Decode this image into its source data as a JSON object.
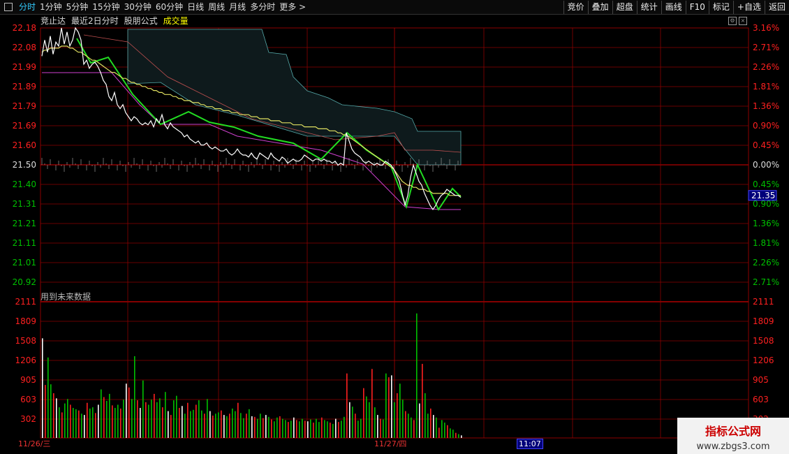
{
  "toolbar": {
    "periods": [
      "分时",
      "1分钟",
      "5分钟",
      "15分钟",
      "30分钟",
      "60分钟",
      "日线",
      "周线",
      "月线",
      "多分时",
      "更多 >"
    ],
    "active_index": 0,
    "right_items": [
      "竞价",
      "叠加",
      "超盘",
      "统计",
      "画线",
      "F10",
      "标记",
      "+自选",
      "返回"
    ]
  },
  "header": {
    "auction": "竞止达",
    "recent": "最近2日分时",
    "formula": "股朋公式",
    "volume": "成交量"
  },
  "price_axis": {
    "left": [
      "22.18",
      "22.08",
      "21.99",
      "21.89",
      "21.79",
      "21.69",
      "21.60",
      "21.50",
      "21.40",
      "21.31",
      "21.21",
      "21.11",
      "21.01",
      "20.92"
    ],
    "right": [
      "3.16%",
      "2.71%",
      "2.26%",
      "1.81%",
      "1.36%",
      "0.90%",
      "0.45%",
      "0.00%",
      "0.45%",
      "0.90%",
      "1.36%",
      "1.81%",
      "2.26%",
      "2.71%"
    ],
    "base_price": 21.5,
    "current_price": "21.35"
  },
  "volume_axis": {
    "labels": [
      "2111",
      "1809",
      "1508",
      "1206",
      "905",
      "603",
      "302"
    ],
    "max": 2111
  },
  "future_note": "用到未来数据",
  "dates": [
    "11/26/三",
    "11/27/四"
  ],
  "cursor_time": "11:07",
  "watermark": {
    "line1": "指标公式网",
    "line2": "www.zbgs3.com"
  },
  "colors": {
    "grid": "#8b0000",
    "up": "#ff2020",
    "down": "#00c000",
    "price": "#ffffff",
    "avg": "#e0e060",
    "accent": "#33ccff"
  },
  "chart_data": {
    "type": "line",
    "title": "",
    "x": [
      0,
      4,
      8,
      12,
      16,
      20,
      24,
      28,
      32,
      36,
      40,
      44,
      48,
      52,
      56,
      60,
      64,
      68,
      72,
      76,
      80,
      84,
      88,
      92,
      96,
      100,
      104,
      108,
      112,
      116,
      120,
      124,
      128,
      132,
      136,
      140,
      144,
      148,
      152,
      156,
      160,
      164,
      168,
      172,
      176,
      180,
      184,
      188,
      192,
      196,
      200,
      204,
      208,
      212,
      216,
      220,
      224,
      228,
      232,
      236,
      240,
      244,
      248,
      252,
      256,
      260,
      264,
      268,
      272,
      276,
      280,
      284,
      288,
      292,
      296,
      300,
      304,
      308,
      312,
      316,
      320,
      324,
      328,
      332,
      336,
      340,
      344,
      348,
      352,
      356,
      360,
      364,
      368,
      372,
      376,
      380,
      384,
      388,
      392,
      396,
      400,
      404,
      408,
      412,
      416,
      420,
      424,
      428,
      432,
      436,
      440,
      444,
      448,
      452,
      456,
      460,
      464,
      468,
      472,
      476,
      480,
      484,
      488,
      492,
      496,
      500,
      504,
      508,
      512,
      516,
      520,
      524,
      528,
      532,
      536,
      540,
      544,
      548,
      552,
      556,
      560,
      564,
      568,
      572,
      576,
      580,
      584,
      588,
      592,
      596,
      600
    ],
    "series": [
      {
        "values": [
          22.04,
          22.12,
          22.06,
          22.14,
          22.05,
          22.11,
          22.09,
          22.18,
          22.1,
          22.16,
          22.09,
          22.12,
          22.18,
          22.16,
          22.12,
          22.0,
          22.02,
          21.98,
          22.0,
          22.01,
          21.99,
          21.96,
          21.92,
          21.9,
          21.84,
          21.82,
          21.86,
          21.8,
          21.78,
          21.8,
          21.76,
          21.74,
          21.72,
          21.74,
          21.73,
          21.71,
          21.7,
          21.71,
          21.7,
          21.72,
          21.69,
          21.73,
          21.71,
          21.75,
          21.7,
          21.68,
          21.71,
          21.69,
          21.68,
          21.67,
          21.66,
          21.64,
          21.65,
          21.63,
          21.62,
          21.61,
          21.62,
          21.6,
          21.6,
          21.61,
          21.59,
          21.58,
          21.59,
          21.58,
          21.57,
          21.57,
          21.58,
          21.56,
          21.55,
          21.56,
          21.58,
          21.56,
          21.55,
          21.55,
          21.54,
          21.56,
          21.54,
          21.53,
          21.56,
          21.55,
          21.54,
          21.53,
          21.56,
          21.54,
          21.53,
          21.52,
          21.54,
          21.53,
          21.51,
          21.52,
          21.53,
          21.52,
          21.52,
          21.53,
          21.55,
          21.54,
          21.53,
          21.52,
          21.53,
          21.53,
          21.52,
          21.53,
          21.52,
          21.52,
          21.51,
          21.52,
          21.5,
          21.51,
          21.5,
          21.66,
          21.62,
          21.58,
          21.56,
          21.55,
          21.54,
          21.52,
          21.51,
          21.52,
          21.51,
          21.5,
          21.51,
          21.5,
          21.5,
          21.52,
          21.51,
          21.5,
          21.48,
          21.45,
          21.42,
          21.36,
          21.3,
          21.35,
          21.44,
          21.5,
          21.46,
          21.42,
          21.4,
          21.36,
          21.33,
          21.3,
          21.28,
          21.3,
          21.33,
          21.35,
          21.36,
          21.38,
          21.37,
          21.36,
          21.35,
          21.35,
          21.34
        ]
      },
      {
        "values": [
          22.06,
          22.07,
          22.07,
          22.08,
          22.08,
          22.08,
          22.08,
          22.09,
          22.09,
          22.09,
          22.08,
          22.08,
          22.07,
          22.06,
          22.06,
          22.05,
          22.04,
          22.03,
          22.02,
          22.02,
          22.01,
          22.0,
          21.99,
          21.98,
          21.97,
          21.96,
          21.96,
          21.95,
          21.94,
          21.93,
          21.93,
          21.92,
          21.91,
          21.91,
          21.9,
          21.9,
          21.89,
          21.89,
          21.88,
          21.88,
          21.87,
          21.87,
          21.86,
          21.86,
          21.85,
          21.85,
          21.85,
          21.84,
          21.84,
          21.83,
          21.83,
          21.82,
          21.82,
          21.82,
          21.81,
          21.81,
          21.81,
          21.8,
          21.8,
          21.79,
          21.79,
          21.79,
          21.78,
          21.78,
          21.78,
          21.77,
          21.77,
          21.77,
          21.76,
          21.76,
          21.76,
          21.75,
          21.75,
          21.75,
          21.75,
          21.74,
          21.74,
          21.74,
          21.73,
          21.73,
          21.73,
          21.73,
          21.72,
          21.72,
          21.72,
          21.72,
          21.71,
          21.71,
          21.71,
          21.71,
          21.7,
          21.7,
          21.7,
          21.7,
          21.69,
          21.69,
          21.69,
          21.69,
          21.69,
          21.68,
          21.68,
          21.68,
          21.68,
          21.67,
          21.67,
          21.67,
          21.66,
          21.66,
          21.65,
          21.65,
          21.64,
          21.63,
          21.62,
          21.61,
          21.6,
          21.59,
          21.58,
          21.57,
          21.56,
          21.55,
          21.54,
          21.53,
          21.52,
          21.51,
          21.5,
          21.49,
          21.48,
          21.46,
          21.44,
          21.42,
          21.41,
          21.4,
          21.4,
          21.39,
          21.39,
          21.38,
          21.38,
          21.38,
          21.37,
          21.37,
          21.36,
          21.36,
          21.36,
          21.36,
          21.36,
          21.36,
          21.35,
          21.35,
          21.35,
          21.35,
          21.35
        ]
      }
    ],
    "volume": [
      1560,
      830,
      1260,
      840,
      700,
      620,
      480,
      400,
      540,
      610,
      520,
      470,
      450,
      430,
      380,
      360,
      550,
      460,
      480,
      390,
      520,
      760,
      640,
      580,
      690,
      510,
      470,
      520,
      460,
      600,
      850,
      790,
      610,
      1280,
      590,
      470,
      900,
      560,
      520,
      600,
      690,
      560,
      620,
      480,
      720,
      420,
      360,
      590,
      660,
      470,
      500,
      380,
      550,
      420,
      440,
      520,
      590,
      430,
      380,
      610,
      420,
      350,
      380,
      400,
      430,
      360,
      340,
      380,
      460,
      420,
      550,
      390,
      310,
      380,
      450,
      340,
      330,
      300,
      380,
      310,
      360,
      330,
      290,
      260,
      320,
      340,
      300,
      280,
      250,
      270,
      320,
      280,
      260,
      300,
      270,
      260,
      290,
      240,
      300,
      250,
      320,
      280,
      260,
      240,
      220,
      300,
      250,
      270,
      330,
      1010,
      560,
      490,
      380,
      270,
      300,
      780,
      650,
      560,
      1080,
      480,
      360,
      300,
      290,
      1010,
      950,
      980,
      560,
      700,
      850,
      600,
      420,
      380,
      320,
      280,
      1950,
      540,
      1160,
      700,
      380,
      460,
      360,
      320,
      160,
      280,
      240,
      200,
      150,
      130,
      80,
      60,
      40
    ],
    "ylim": [
      20.92,
      22.18
    ]
  }
}
